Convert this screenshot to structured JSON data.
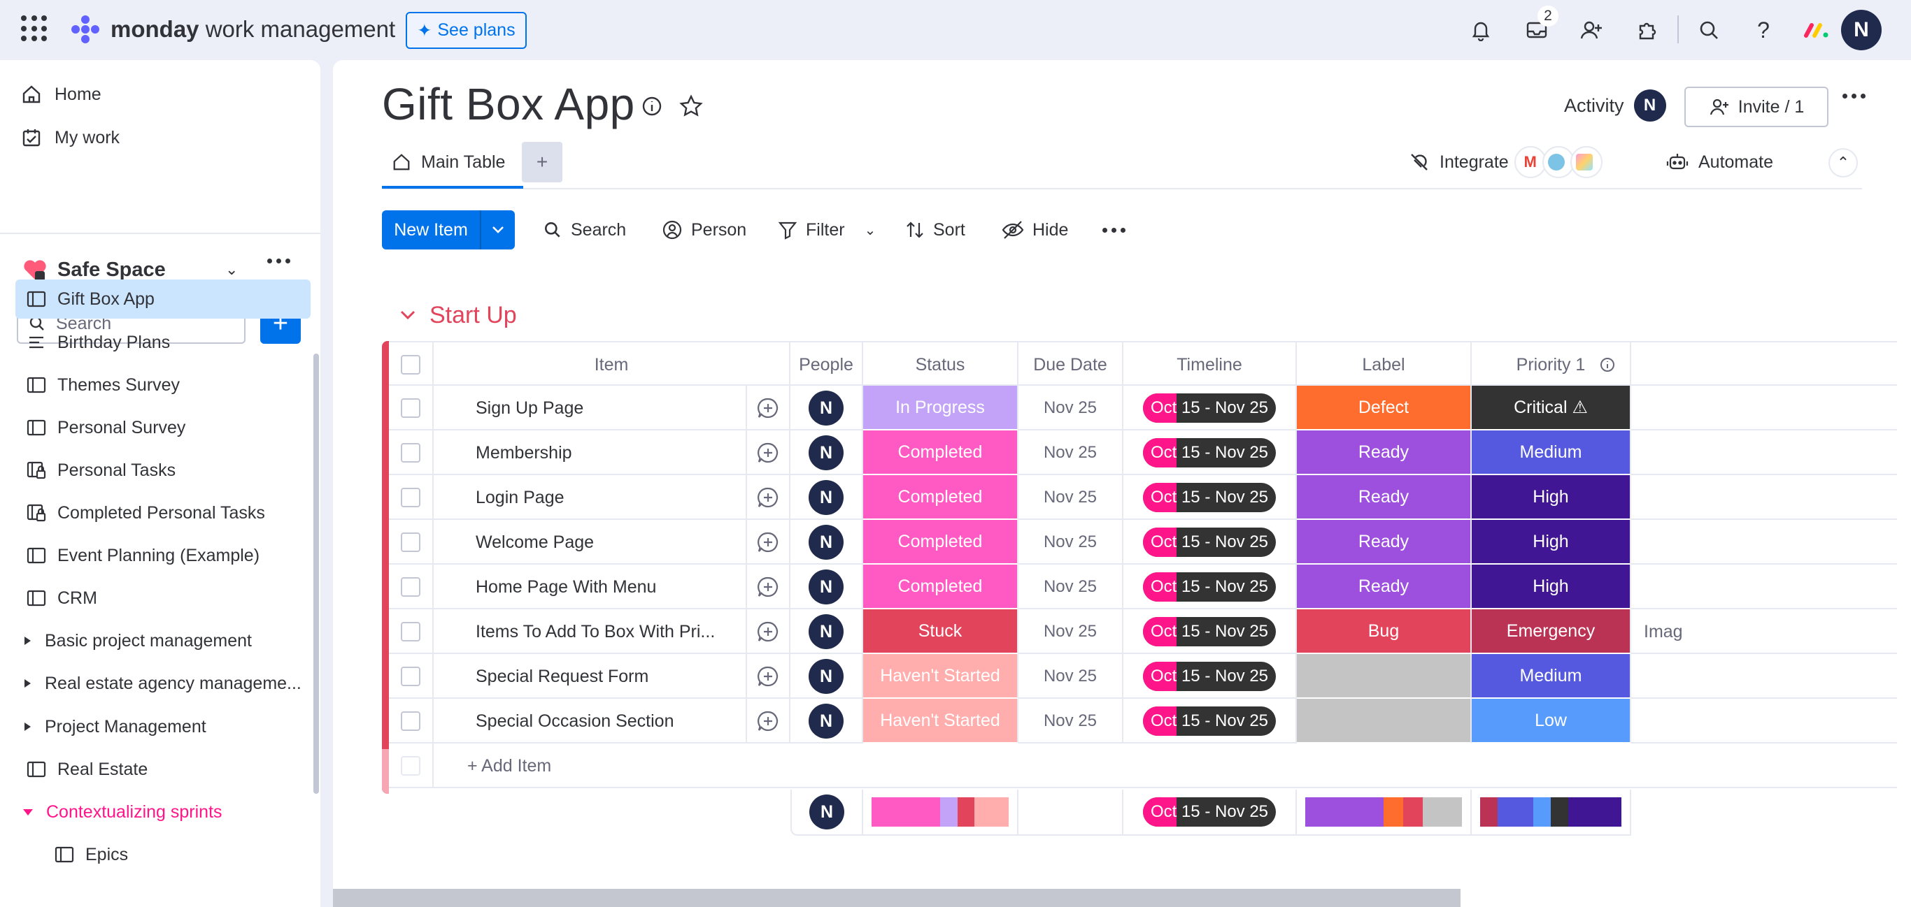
{
  "topbar": {
    "brand_bold": "monday",
    "brand_rest": " work management",
    "see_plans": "See plans",
    "inbox_badge": "2",
    "avatar": "N"
  },
  "sidebar": {
    "home": "Home",
    "my_work": "My work",
    "workspace": "Safe Space",
    "search_placeholder": "Search",
    "plus": "+",
    "items": [
      {
        "label": "Gift Box App",
        "icon": "board-icon",
        "active": true
      },
      {
        "label": "Birthday Plans",
        "icon": "list-icon"
      },
      {
        "label": "Themes Survey",
        "icon": "board-icon"
      },
      {
        "label": "Personal Survey",
        "icon": "board-icon"
      },
      {
        "label": "Personal Tasks",
        "icon": "private-board-icon"
      },
      {
        "label": "Completed Personal Tasks",
        "icon": "private-board-icon"
      },
      {
        "label": "Event Planning (Example)",
        "icon": "board-icon"
      },
      {
        "label": "CRM",
        "icon": "board-icon"
      },
      {
        "label": "Basic project management",
        "icon": "folder-caret-icon"
      },
      {
        "label": "Real estate agency manageme...",
        "icon": "folder-caret-icon"
      },
      {
        "label": "Project Management",
        "icon": "folder-caret-icon"
      },
      {
        "label": "Real Estate",
        "icon": "board-icon"
      },
      {
        "label": "Contextualizing sprints",
        "icon": "folder-open-icon"
      },
      {
        "label": "Epics",
        "icon": "board-icon"
      }
    ]
  },
  "board": {
    "title": "Gift Box App",
    "activity": "Activity",
    "activity_avatar": "N",
    "invite": "Invite / 1",
    "tab_main": "Main Table",
    "tab_add": "+",
    "integrate": "Integrate",
    "automate": "Automate"
  },
  "toolbar": {
    "new_item": "New Item",
    "search": "Search",
    "person": "Person",
    "filter": "Filter",
    "sort": "Sort",
    "hide": "Hide"
  },
  "group": {
    "title": "Start Up",
    "columns": [
      "Item",
      "People",
      "Status",
      "Due Date",
      "Timeline",
      "Label",
      "Priority 1"
    ],
    "rows": [
      {
        "item": "Sign Up Page",
        "person": "N",
        "status": "In Progress",
        "status_color": "#c2a3f7",
        "due": "Nov 25",
        "timeline": "Oct 15 - Nov 25",
        "label": "Defect",
        "label_color": "#ff6d2e",
        "priority": "Critical ⚠",
        "priority_color": "#333333"
      },
      {
        "item": "Membership",
        "person": "N",
        "status": "Completed",
        "status_color": "#ff5ac4",
        "due": "Nov 25",
        "timeline": "Oct 15 - Nov 25",
        "label": "Ready",
        "label_color": "#9d50dd",
        "priority": "Medium",
        "priority_color": "#5559df"
      },
      {
        "item": "Login Page",
        "person": "N",
        "status": "Completed",
        "status_color": "#ff5ac4",
        "due": "Nov 25",
        "timeline": "Oct 15 - Nov 25",
        "label": "Ready",
        "label_color": "#9d50dd",
        "priority": "High",
        "priority_color": "#401694"
      },
      {
        "item": "Welcome Page",
        "person": "N",
        "status": "Completed",
        "status_color": "#ff5ac4",
        "due": "Nov 25",
        "timeline": "Oct 15 - Nov 25",
        "label": "Ready",
        "label_color": "#9d50dd",
        "priority": "High",
        "priority_color": "#401694"
      },
      {
        "item": "Home Page With Menu",
        "person": "N",
        "status": "Completed",
        "status_color": "#ff5ac4",
        "due": "Nov 25",
        "timeline": "Oct 15 - Nov 25",
        "label": "Ready",
        "label_color": "#9d50dd",
        "priority": "High",
        "priority_color": "#401694"
      },
      {
        "item": "Items To Add To Box With Pri...",
        "person": "N",
        "status": "Stuck",
        "status_color": "#e2445c",
        "due": "Nov 25",
        "timeline": "Oct 15 - Nov 25",
        "label": "Bug",
        "label_color": "#e2445c",
        "priority": "Emergency",
        "priority_color": "#bb3354",
        "extra": "Imag"
      },
      {
        "item": "Special Request Form",
        "person": "N",
        "status": "Haven't Started",
        "status_color": "#ffadad",
        "due": "Nov 25",
        "timeline": "Oct 15 - Nov 25",
        "label": "",
        "label_color": "#c4c4c4",
        "priority": "Medium",
        "priority_color": "#5559df"
      },
      {
        "item": "Special Occasion Section",
        "person": "N",
        "status": "Haven't Started",
        "status_color": "#ffadad",
        "due": "Nov 25",
        "timeline": "Oct 15 - Nov 25",
        "label": "",
        "label_color": "#c4c4c4",
        "priority": "Low",
        "priority_color": "#579bfc"
      }
    ],
    "add_item": "+ Add Item",
    "summary": {
      "person": "N",
      "timeline": "Oct 15 - Nov 25",
      "status_segments": [
        {
          "color": "#ff5ac4",
          "share": 0.5
        },
        {
          "color": "#c2a3f7",
          "share": 0.125
        },
        {
          "color": "#e2445c",
          "share": 0.125
        },
        {
          "color": "#ffadad",
          "share": 0.25
        }
      ],
      "label_segments": [
        {
          "color": "#9d50dd",
          "share": 0.5
        },
        {
          "color": "#ff6d2e",
          "share": 0.125
        },
        {
          "color": "#e2445c",
          "share": 0.125
        },
        {
          "color": "#c4c4c4",
          "share": 0.25
        }
      ],
      "priority_segments": [
        {
          "color": "#bb3354",
          "share": 0.125
        },
        {
          "color": "#5559df",
          "share": 0.25
        },
        {
          "color": "#579bfc",
          "share": 0.125
        },
        {
          "color": "#333333",
          "share": 0.125
        },
        {
          "color": "#401694",
          "share": 0.375
        }
      ]
    }
  }
}
